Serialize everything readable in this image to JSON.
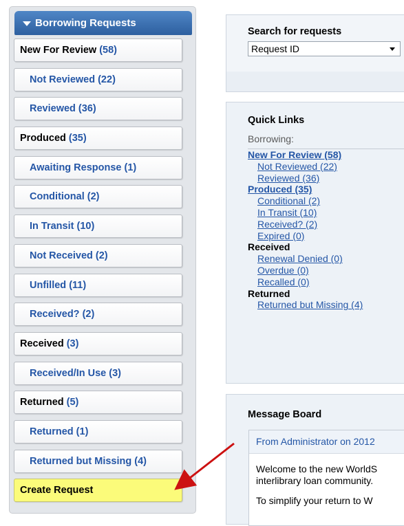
{
  "sidebar": {
    "header_label": "Borrowing Requests",
    "items": [
      {
        "label": "New For Review",
        "count": "(58)",
        "sub": false
      },
      {
        "label": "Not Reviewed (22)",
        "count": "",
        "sub": true
      },
      {
        "label": "Reviewed (36)",
        "count": "",
        "sub": true
      },
      {
        "label": "Produced",
        "count": "(35)",
        "sub": false
      },
      {
        "label": "Awaiting Response (1)",
        "count": "",
        "sub": true
      },
      {
        "label": "Conditional (2)",
        "count": "",
        "sub": true
      },
      {
        "label": "In Transit (10)",
        "count": "",
        "sub": true
      },
      {
        "label": "Not Received (2)",
        "count": "",
        "sub": true
      },
      {
        "label": "Unfilled (11)",
        "count": "",
        "sub": true
      },
      {
        "label": "Received? (2)",
        "count": "",
        "sub": true
      },
      {
        "label": "Received",
        "count": "(3)",
        "sub": false
      },
      {
        "label": "Received/In Use (3)",
        "count": "",
        "sub": true
      },
      {
        "label": "Returned",
        "count": "(5)",
        "sub": false
      },
      {
        "label": "Returned (1)",
        "count": "",
        "sub": true
      },
      {
        "label": "Returned but Missing (4)",
        "count": "",
        "sub": true
      }
    ],
    "create_request_label": "Create Request",
    "highlight_color": "#fbfb7a"
  },
  "search": {
    "title": "Search for requests",
    "selected": "Request ID"
  },
  "quick_links": {
    "title": "Quick Links",
    "subtitle": "Borrowing:",
    "new_for_review": "New For Review (58)",
    "not_reviewed": "Not Reviewed (22)",
    "reviewed": "Reviewed (36)",
    "produced": "Produced (35)",
    "conditional": "Conditional (2)",
    "in_transit": "In Transit (10)",
    "received_q": "Received? (2)",
    "expired": "Expired (0)",
    "received_cat": "Received",
    "renewal_denied": "Renewal Denied (0)",
    "overdue": "Overdue (0)",
    "recalled": "Recalled (0)",
    "returned_cat": "Returned",
    "returned_missing": "Returned but Missing (4)"
  },
  "message_board": {
    "title": "Message Board",
    "header": "From Administrator on 2012",
    "line1": "Welcome to the new WorldS",
    "line2": "interlibrary loan community.",
    "line3": "To simplify your return to W"
  },
  "colors": {
    "accent": "#2d5f9f",
    "link": "#2456a6",
    "annotation_arrow": "#cc1111"
  }
}
